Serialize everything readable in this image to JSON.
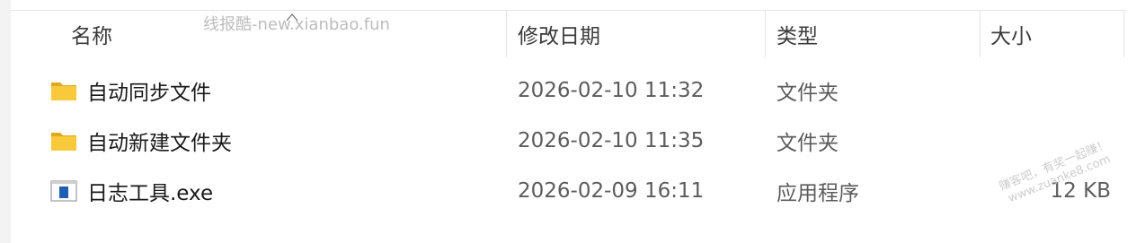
{
  "columns": {
    "name": "名称",
    "date": "修改日期",
    "type": "类型",
    "size": "大小"
  },
  "watermark": "线报酷-new.xianbao.fun",
  "stamp_lines": [
    "赚客吧，有奖一起赚！",
    "www.zuanke8.com"
  ],
  "files": [
    {
      "name": "自动同步文件",
      "date": "2026-02-10 11:32",
      "type": "文件夹",
      "size": "",
      "icon": "folder-icon"
    },
    {
      "name": "自动新建文件夹",
      "date": "2026-02-10 11:35",
      "type": "文件夹",
      "size": "",
      "icon": "folder-icon"
    },
    {
      "name": "日志工具.exe",
      "date": "2026-02-09 16:11",
      "type": "应用程序",
      "size": "12 KB",
      "icon": "exe-icon"
    }
  ],
  "colors": {
    "folder": "#f8c93a",
    "folder_dark": "#e0a820",
    "exe_blue": "#1e5fb4",
    "divider": "#e5e5e5"
  }
}
